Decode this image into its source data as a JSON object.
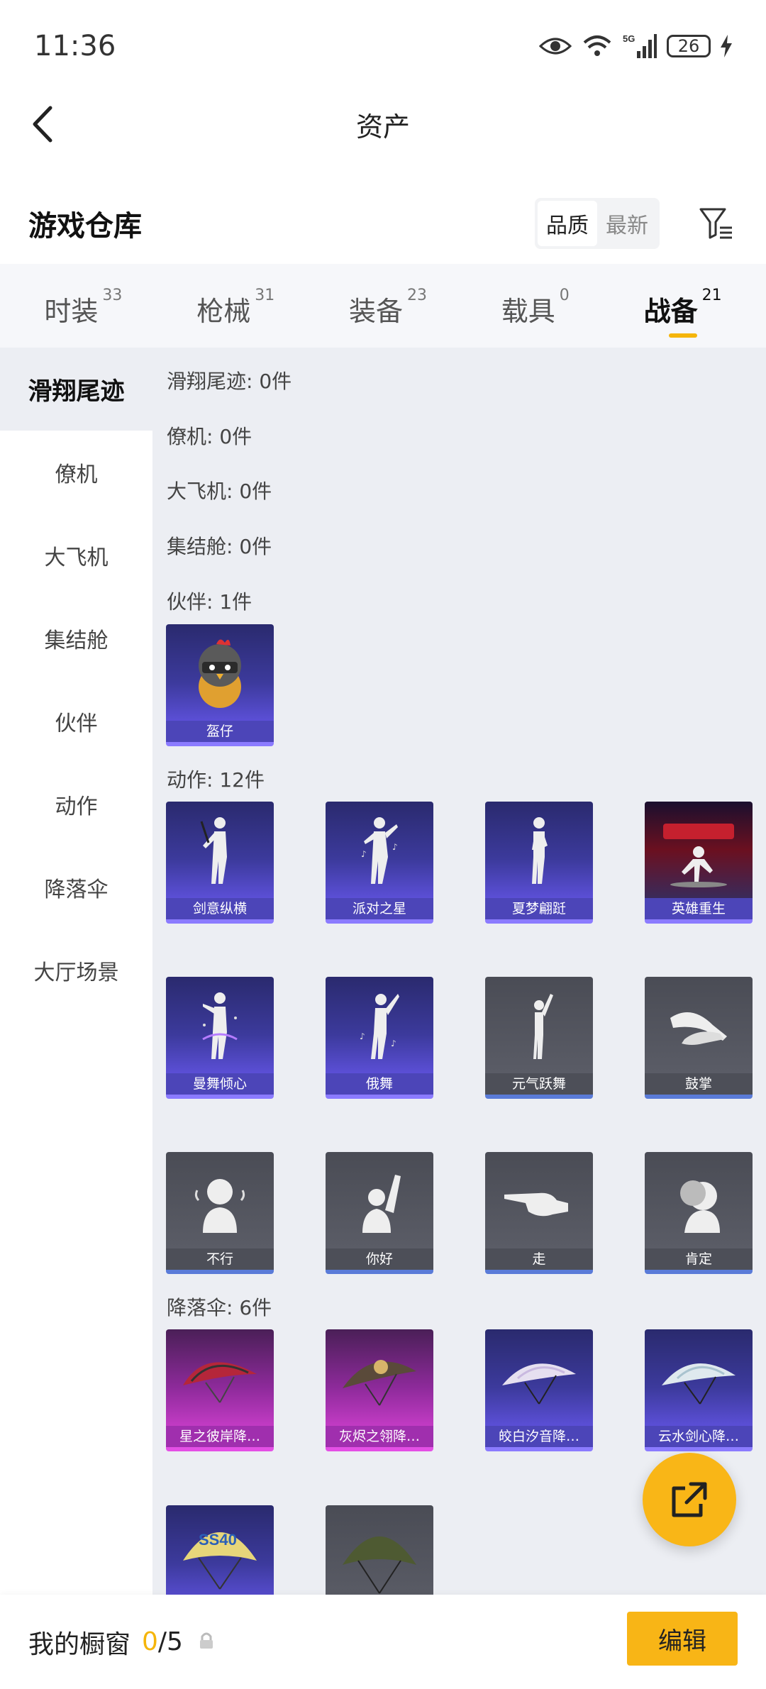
{
  "status": {
    "time": "11:36",
    "network": "5G",
    "battery": "26"
  },
  "header": {
    "title": "资产"
  },
  "warehouse": {
    "title": "游戏仓库",
    "sort_options": [
      "品质",
      "最新"
    ],
    "sort_selected": "品质"
  },
  "tabs": [
    {
      "label": "时装",
      "count": "33"
    },
    {
      "label": "枪械",
      "count": "31"
    },
    {
      "label": "装备",
      "count": "23"
    },
    {
      "label": "载具",
      "count": "0"
    },
    {
      "label": "战备",
      "count": "21",
      "active": true
    }
  ],
  "sidebar": [
    {
      "label": "滑翔尾迹",
      "active": true
    },
    {
      "label": "僚机"
    },
    {
      "label": "大飞机"
    },
    {
      "label": "集结舱"
    },
    {
      "label": "伙伴"
    },
    {
      "label": "动作"
    },
    {
      "label": "降落伞"
    },
    {
      "label": "大厅场景"
    }
  ],
  "sections": {
    "glide": "滑翔尾迹: 0件",
    "wingman": "僚机: 0件",
    "plane": "大飞机: 0件",
    "pod": "集结舱: 0件",
    "partner": "伙伴: 1件",
    "emote": "动作: 12件",
    "parachute": "降落伞: 6件"
  },
  "partner_items": [
    "盔仔"
  ],
  "emote_items": [
    "剑意纵横",
    "派对之星",
    "夏梦翩跹",
    "英雄重生",
    "曼舞倾心",
    "俄舞",
    "元气跃舞",
    "鼓掌",
    "不行",
    "你好",
    "走",
    "肯定"
  ],
  "parachute_items": [
    "星之彼岸降…",
    "灰烬之翎降…",
    "皎白汐音降…",
    "云水剑心降…"
  ],
  "card_art_text": {
    "ss40": "SS40"
  },
  "bottom": {
    "showcase_label": "我的橱窗",
    "showcase_current": "0",
    "showcase_total": "/5",
    "edit_label": "编辑"
  },
  "colors": {
    "accent": "#f5b50a",
    "purple_card": "#4c45b8",
    "grey_card": "#4d4f58",
    "magenta_card": "#a02fae"
  }
}
